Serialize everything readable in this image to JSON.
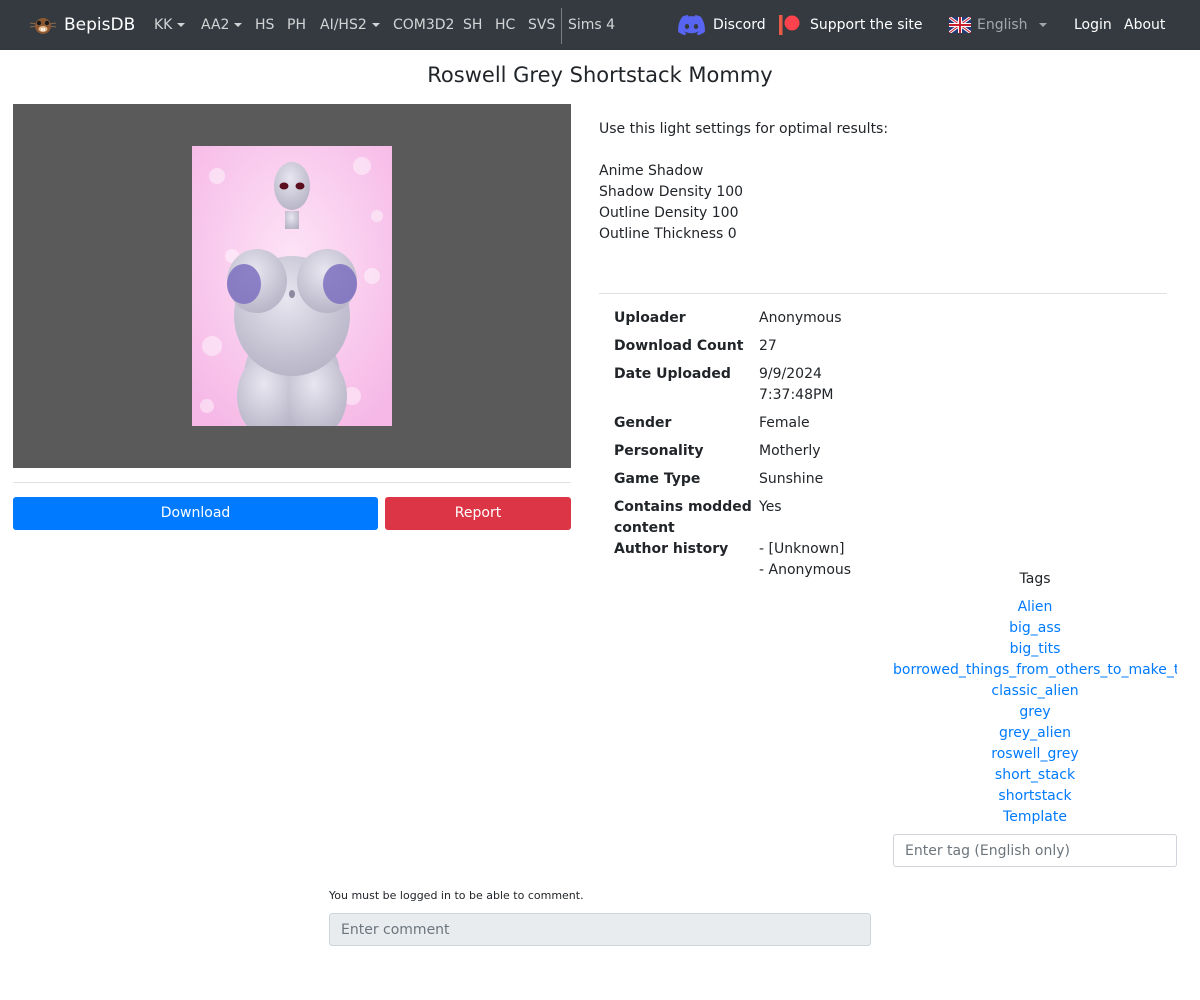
{
  "nav": {
    "brand": "BepisDB",
    "brand_icon": "bepis-mascot-icon",
    "items": [
      {
        "label": "KK",
        "dropdown": true
      },
      {
        "label": "AA2",
        "dropdown": true
      },
      {
        "label": "HS",
        "dropdown": false
      },
      {
        "label": "PH",
        "dropdown": false
      },
      {
        "label": "AI/HS2",
        "dropdown": true
      },
      {
        "label": "COM3D2",
        "dropdown": false
      },
      {
        "label": "SH",
        "dropdown": false
      },
      {
        "label": "HC",
        "dropdown": false
      },
      {
        "label": "SVS",
        "dropdown": false
      },
      {
        "label": "Sims 4",
        "dropdown": false
      }
    ],
    "discord": "Discord",
    "support": "Support the site",
    "language": "English",
    "login": "Login",
    "about": "About"
  },
  "card": {
    "title": "Roswell Grey Shortstack Mommy",
    "description": [
      "Use this light settings for optimal results:",
      "",
      "Anime Shadow",
      "Shadow Density 100",
      "Outline Density 100",
      "Outline Thickness 0"
    ],
    "download_label": "Download",
    "report_label": "Report"
  },
  "info": [
    {
      "label": "Uploader",
      "value": "Anonymous"
    },
    {
      "label": "Download Count",
      "value": "27"
    },
    {
      "label": "Date Uploaded",
      "value": "9/9/2024\n7:37:48PM"
    },
    {
      "label": "Gender",
      "value": "Female"
    },
    {
      "label": "Personality",
      "value": "Motherly"
    },
    {
      "label": "Game Type",
      "value": "Sunshine"
    },
    {
      "label": "Contains modded content",
      "value": "Yes"
    },
    {
      "label": "Author history",
      "value": "- [Unknown]\n- Anonymous"
    }
  ],
  "tags": {
    "title": "Tags",
    "items": [
      "Alien",
      "big_ass",
      "big_tits",
      "borrowed_things_from_others_to_make_th",
      "classic_alien",
      "grey",
      "grey_alien",
      "roswell_grey",
      "short_stack",
      "shortstack",
      "Template"
    ],
    "input_placeholder": "Enter tag (English only)"
  },
  "comments": {
    "login_note": "You must be logged in to be able to comment.",
    "placeholder": "Enter comment"
  },
  "colors": {
    "navbar": "#343a40",
    "primary": "#007bff",
    "danger": "#dc3545",
    "link": "#007bff"
  }
}
